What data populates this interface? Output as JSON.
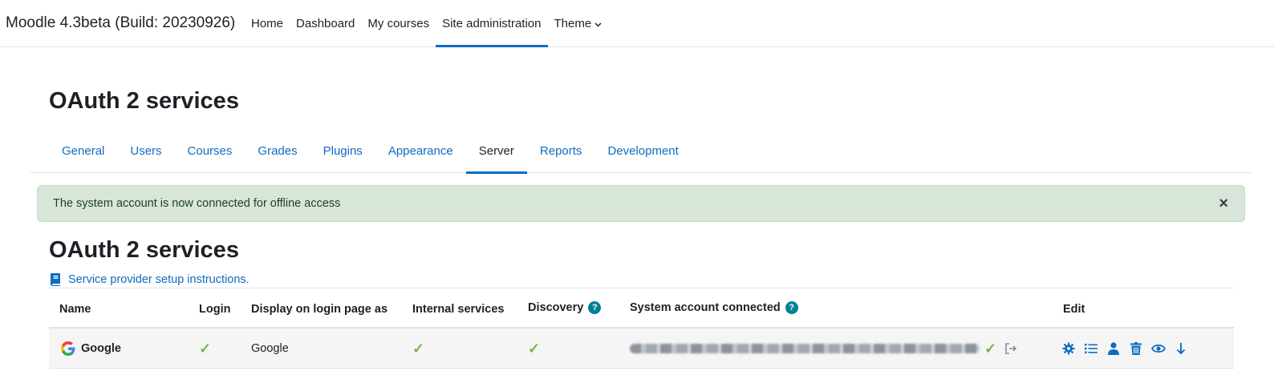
{
  "navbar": {
    "site_name": "Moodle 4.3beta (Build: 20230926)",
    "links": [
      "Home",
      "Dashboard",
      "My courses",
      "Site administration",
      "Theme"
    ],
    "active_link": "Site administration"
  },
  "page": {
    "title": "OAuth 2 services"
  },
  "secondary_nav": {
    "tabs": [
      "General",
      "Users",
      "Courses",
      "Grades",
      "Plugins",
      "Appearance",
      "Server",
      "Reports",
      "Development"
    ],
    "active_tab": "Server"
  },
  "alert": {
    "message": "The system account is now connected for offline access",
    "close_label": "×"
  },
  "section": {
    "title": "OAuth 2 services",
    "instructions_link": "Service provider setup instructions."
  },
  "table": {
    "headers": {
      "name": "Name",
      "login": "Login",
      "display": "Display on login page as",
      "internal": "Internal services",
      "discovery": "Discovery",
      "system_account": "System account connected",
      "edit": "Edit"
    },
    "help_mark": "?",
    "tick_mark": "✓",
    "rows": [
      {
        "name": "Google",
        "login": true,
        "display": "Google",
        "internal": true,
        "discovery": true,
        "system_account_connected": true
      }
    ]
  },
  "colors": {
    "accent": "#0f6cbf",
    "alert_bg": "#d7e6d9",
    "tick": "#7cb342",
    "help": "#008196"
  }
}
